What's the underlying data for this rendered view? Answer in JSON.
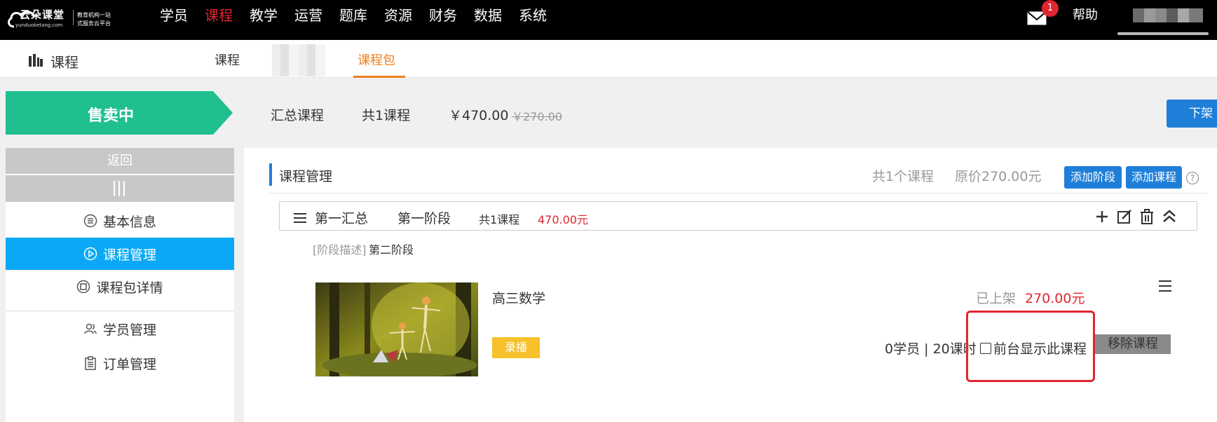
{
  "logo": {
    "name": "云朵课堂",
    "url": "yunduoketang.com",
    "tagline_1": "教育机构一站",
    "tagline_2": "式服务云平台"
  },
  "topnav": {
    "items": [
      {
        "label": "学员",
        "active": false
      },
      {
        "label": "课程",
        "active": true
      },
      {
        "label": "教学",
        "active": false
      },
      {
        "label": "运营",
        "active": false
      },
      {
        "label": "题库",
        "active": false
      },
      {
        "label": "资源",
        "active": false
      },
      {
        "label": "财务",
        "active": false
      },
      {
        "label": "数据",
        "active": false
      },
      {
        "label": "系统",
        "active": false
      }
    ],
    "mail_badge": "1",
    "help": "帮助"
  },
  "subnav": {
    "title": "课程",
    "tabs": [
      {
        "label": "课程",
        "active": false
      },
      {
        "label": "课程包",
        "active": true
      }
    ]
  },
  "status": {
    "label": "售卖中",
    "summary": "汇总课程",
    "course_count": "共1课程",
    "price": "￥470.00",
    "original_price": "￥270.00",
    "off_shelf": "下架"
  },
  "sidebar": {
    "back": "返回",
    "items": [
      {
        "label": "基本信息",
        "icon": "list-circle-icon",
        "active": false
      },
      {
        "label": "课程管理",
        "icon": "play-circle-icon",
        "active": true
      },
      {
        "label": "课程包详情",
        "icon": "package-icon",
        "active": false
      },
      {
        "label": "学员管理",
        "icon": "users-icon",
        "active": false
      },
      {
        "label": "订单管理",
        "icon": "clipboard-icon",
        "active": false
      }
    ]
  },
  "main": {
    "title": "课程管理",
    "course_count": "共1个课程",
    "original_price": "原价270.00元",
    "add_stage": "添加阶段",
    "add_course": "添加课程",
    "help": "?"
  },
  "stage": {
    "summary": "第一汇总",
    "name": "第一阶段",
    "course_count": "共1课程",
    "price": "470.00元",
    "description_label": "[阶段描述]",
    "description_value": "第二阶段"
  },
  "course": {
    "name": "高三数学",
    "tag": "录播",
    "status": "已上架",
    "price": "270.00元",
    "stats": "0学员 | 20课时",
    "show_front": "前台显示此课程",
    "show_front_checked": false,
    "remove": "移除课程"
  },
  "colors": {
    "accent_red": "#e0262f",
    "brand_blue": "#1f7fd8",
    "sidebar_active": "#0aa8f5",
    "ribbon_green": "#1fbf8f",
    "tab_orange": "#f07f1e",
    "tag_yellow": "#f6c12b"
  }
}
